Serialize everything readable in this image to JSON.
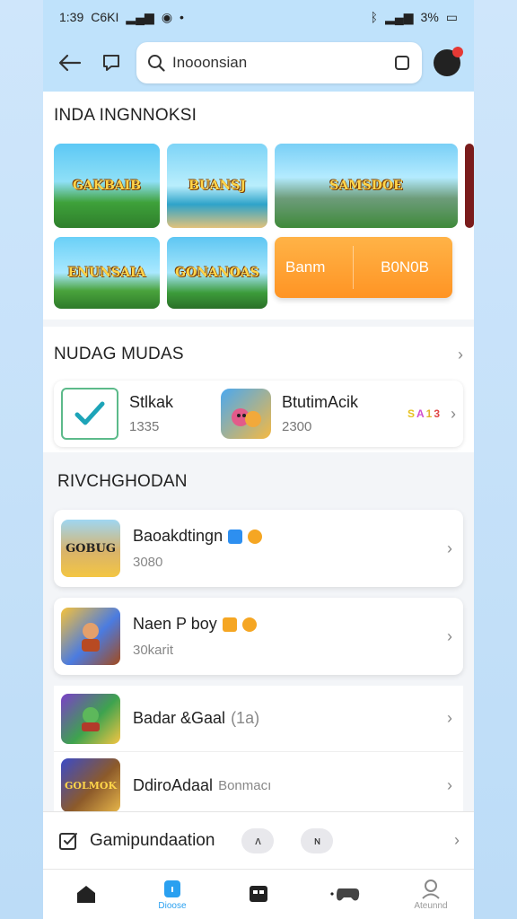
{
  "status": {
    "time": "1:39",
    "carrier": "C6KI",
    "battery": "3%"
  },
  "search": {
    "value": "Inooonsian",
    "placeholder": ""
  },
  "colors": {
    "accent": "#2aa0f0",
    "orange": "#ff9a2e",
    "header": "#bfe2fb"
  },
  "hero": {
    "title": "INDA INGNNOKSI",
    "tiles": [
      "GAKBAIB",
      "BUANSJ",
      "SAMSDOE",
      "ENUNSAIA",
      "GONANOAS"
    ],
    "orange_left": "Banm",
    "orange_right": "B0N0B"
  },
  "popular": {
    "title": "NUDAG MUDAS",
    "items": [
      {
        "name": "Stlkak",
        "count": "1335",
        "icon": "check-icon"
      },
      {
        "name": "BtutimAcik",
        "count": "2300",
        "icon": "game-icon"
      }
    ],
    "mini_badges": [
      "S",
      "A",
      "1",
      "3"
    ]
  },
  "list": {
    "title": "RIVCHGHODAN",
    "items": [
      {
        "name": "Baoakdtingn",
        "sub": "3080",
        "extra": "",
        "badges": [
          "blue",
          "orange"
        ],
        "icon": "GOBUG"
      },
      {
        "name": "Naen P boy",
        "sub": "30karit",
        "extra": "",
        "badges": [
          "orange",
          "orange"
        ],
        "icon": ""
      },
      {
        "name": "Badar &Gaal",
        "sub": "",
        "extra": "(1a)",
        "badges": [],
        "icon": ""
      },
      {
        "name": "DdiroAdaal",
        "sub": "",
        "extra": "Bonmacı",
        "badges": [],
        "icon": "GOLMOK"
      }
    ]
  },
  "bottom_row": {
    "label": "Gamipundaation",
    "pill1": "ᴧ",
    "pill2": "ɴ"
  },
  "tabs": [
    {
      "label": "",
      "icon": "home-icon"
    },
    {
      "label": "Dioose",
      "icon": "store-icon"
    },
    {
      "label": "",
      "icon": "grid-icon"
    },
    {
      "label": "",
      "icon": "gamepad-icon"
    },
    {
      "label": "Ateunnd",
      "icon": "profile-icon"
    }
  ]
}
